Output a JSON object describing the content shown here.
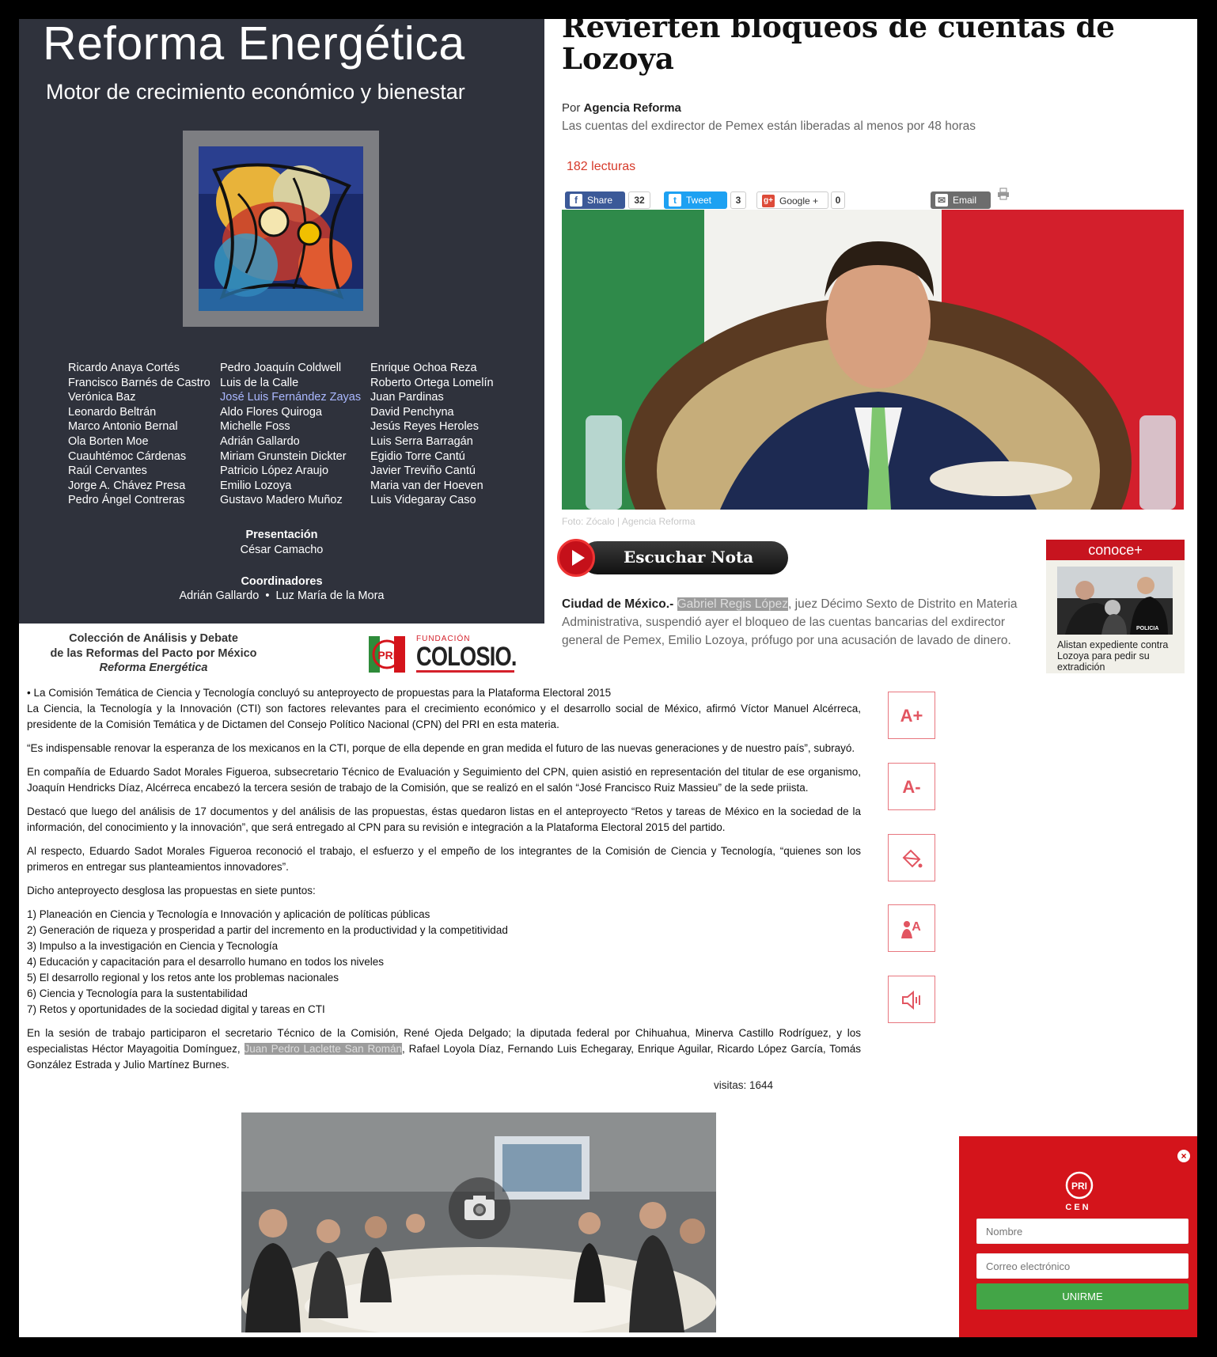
{
  "cover": {
    "title": "Reforma Energética",
    "subtitle": "Motor de crecimiento económico y bienestar",
    "authors_col1": [
      "Ricardo Anaya Cortés",
      "Francisco Barnés de Castro",
      "Verónica Baz",
      "Leonardo Beltrán",
      "Marco Antonio Bernal",
      "Ola Borten Moe",
      "Cuauhtémoc Cárdenas",
      "Raúl Cervantes",
      "Jorge A. Chávez Presa",
      "Pedro Ángel Contreras"
    ],
    "authors_col2": [
      "Pedro Joaquín Coldwell",
      "Luis de la Calle",
      "José Luis Fernández Zayas",
      "Aldo Flores Quiroga",
      "Michelle Foss",
      "Adrián Gallardo",
      "Miriam Grunstein Dickter",
      "Patricio López Araujo",
      "Emilio Lozoya",
      "Gustavo Madero Muñoz"
    ],
    "authors_col3": [
      "Enrique Ochoa Reza",
      "Roberto Ortega Lomelín",
      "Juan Pardinas",
      "David Penchyna",
      "Jesús Reyes Heroles",
      "Luis Serra Barragán",
      "Egidio Torre Cantú",
      "Javier Treviño Cantú",
      "Maria van der Hoeven",
      "Luis Videgaray Caso"
    ],
    "presentation_label": "Presentación",
    "presentation_name": "César Camacho",
    "coordinators_label": "Coordinadores",
    "coordinators_names": "Adrián Gallardo  •  Luz María de la Mora"
  },
  "collection": {
    "line1": "Colección de Análisis y Debate",
    "line2": "de las Reformas del Pacto por México",
    "line3": "Reforma Energética",
    "colosio_small": "FUNDACIÓN",
    "colosio_big": "COLOSIO."
  },
  "news": {
    "headline": "Revierten bloqueos de cuentas de Lozoya",
    "byline_prefix": "Por",
    "byline_source": "Agencia Reforma",
    "summary": "Las cuentas del exdirector de Pemex están liberadas al menos por 48 horas",
    "reads": "182 lecturas",
    "share": {
      "facebook": "Share",
      "facebook_count": "32",
      "twitter": "Tweet",
      "twitter_count": "3",
      "google": "Google +",
      "google_count": "0",
      "email": "Email"
    },
    "caption": "Foto: Zócalo | Agencia Reforma",
    "listen": "Escuchar Nota",
    "body_lead": "Ciudad de México.-",
    "body_highlight": "Gabriel Regis López",
    "body_rest": ", juez Décimo Sexto de Distrito en Materia Administrativa, suspendió ayer el bloqueo de las cuentas bancarias del exdirector general de Pemex, Emilio Lozoya, prófugo por una acusación de lavado de dinero."
  },
  "conoce": {
    "header": "conoce+",
    "badge": "POLICIA",
    "headline": "Alistan expediente contra Lozoya para pedir su extradición"
  },
  "press": {
    "p1": "• La Comisión Temática de Ciencia y Tecnología concluyó su anteproyecto de propuestas para la Plataforma Electoral 2015",
    "p2": "La Ciencia, la Tecnología y la Innovación (CTI) son factores relevantes para el crecimiento económico y el desarrollo social de México, afirmó Víctor Manuel Alcérreca, presidente de la Comisión Temática y de Dictamen del Consejo Político Nacional (CPN) del PRI en esta materia.",
    "p3": "“Es indispensable renovar la esperanza de los mexicanos en la CTI, porque de ella depende en gran medida el futuro de las nuevas generaciones y de nuestro país”, subrayó.",
    "p4": "En compañía de Eduardo Sadot Morales Figueroa, subsecretario Técnico de Evaluación y Seguimiento del CPN, quien asistió en representación del titular de ese organismo, Joaquín Hendricks Díaz, Alcérreca encabezó la tercera sesión de trabajo de la Comisión, que se realizó en el salón “José Francisco Ruiz Massieu” de la sede priista.",
    "p5": "Destacó que luego del análisis de 17 documentos y del análisis de las propuestas, éstas quedaron listas en el anteproyecto “Retos y tareas de México en la sociedad de la información, del conocimiento y la innovación”, que será entregado al CPN para su revisión e integración a la Plataforma Electoral 2015 del partido.",
    "p6": "Al respecto, Eduardo Sadot Morales Figueroa reconoció el trabajo, el esfuerzo y el empeño de los integrantes de la Comisión de Ciencia y Tecnología, “quienes son los primeros en entregar sus planteamientos innovadores”.",
    "p7": "Dicho anteproyecto desglosa las propuestas en siete puntos:",
    "points": [
      "1) Planeación en Ciencia y Tecnología e Innovación y aplicación de políticas públicas",
      "2) Generación de riqueza y prosperidad a partir del incremento en la productividad y la competitividad",
      "3) Impulso a la investigación en Ciencia y Tecnología",
      "4) Educación y capacitación para el desarrollo humano en todos los niveles",
      "5) El desarrollo regional y los retos ante los problemas nacionales",
      "6) Ciencia y Tecnología para la sustentabilidad",
      "7) Retos y oportunidades de la sociedad digital y tareas en CTI"
    ],
    "p8_before": "En la sesión de trabajo participaron el secretario Técnico de la Comisión, René Ojeda Delgado; la diputada federal por Chihuahua, Minerva Castillo Rodríguez, y los especialistas Héctor Mayagoitia Domínguez, ",
    "p8_highlight": "Juan Pedro Laclette San Román",
    "p8_after": ", Rafael Loyola Díaz, Fernando Luis Echegaray, Enrique Aguilar, Ricardo López García, Tomás González Estrada y Julio Martínez Burnes.",
    "visits": "visitas: 1644"
  },
  "tools": {
    "increase": "A+",
    "decrease": "A-"
  },
  "signup": {
    "logo_label": "CEN",
    "name_placeholder": "Nombre",
    "email_placeholder": "Correo electrónico",
    "button": "UNIRME"
  },
  "colors": {
    "pri_red": "#d4141b",
    "cover_bg": "#2f323c",
    "accent_red": "#d63a2a",
    "facebook": "#3b5998",
    "twitter": "#1da1f2",
    "google": "#dd4b39",
    "signup_green": "#43a547"
  }
}
